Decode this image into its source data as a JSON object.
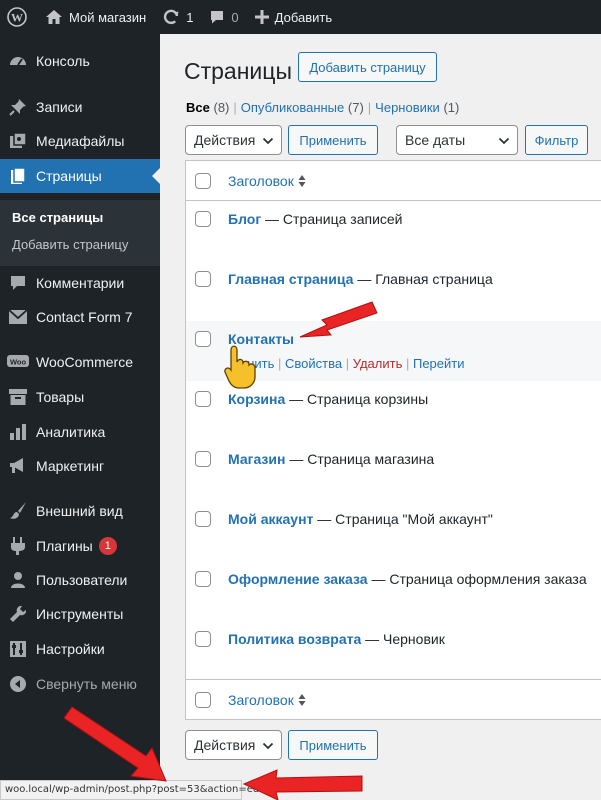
{
  "adminbar": {
    "site_name": "Мой магазин",
    "updates_count": "1",
    "comments_count": "0",
    "new_label": "Добавить"
  },
  "menu": {
    "items": [
      {
        "label": "Консоль",
        "icon": "dashboard-icon"
      },
      {
        "label": "Записи",
        "icon": "pin-icon"
      },
      {
        "label": "Медиафайлы",
        "icon": "media-icon"
      },
      {
        "label": "Страницы",
        "icon": "pages-icon"
      },
      {
        "label": "Комментарии",
        "icon": "comment-icon"
      },
      {
        "label": "Contact Form 7",
        "icon": "mail-icon"
      },
      {
        "label": "WooCommerce",
        "icon": "woo-icon"
      },
      {
        "label": "Товары",
        "icon": "archive-icon"
      },
      {
        "label": "Аналитика",
        "icon": "chart-icon"
      },
      {
        "label": "Маркетинг",
        "icon": "megaphone-icon"
      },
      {
        "label": "Внешний вид",
        "icon": "brush-icon"
      },
      {
        "label": "Плагины",
        "icon": "plugin-icon",
        "badge": "1"
      },
      {
        "label": "Пользователи",
        "icon": "users-icon"
      },
      {
        "label": "Инструменты",
        "icon": "wrench-icon"
      },
      {
        "label": "Настройки",
        "icon": "settings-icon"
      },
      {
        "label": "Свернуть меню",
        "icon": "collapse-icon"
      }
    ],
    "submenu": [
      "Все страницы",
      "Добавить страницу"
    ]
  },
  "page": {
    "title": "Страницы",
    "add_new": "Добавить страницу",
    "views": [
      {
        "label": "Все",
        "count": "(8)"
      },
      {
        "label": "Опубликованные",
        "count": "(7)"
      },
      {
        "label": "Черновики",
        "count": "(1)"
      }
    ],
    "bulk_actions": "Действия",
    "apply": "Применить",
    "dates": "Все даты",
    "filter": "Фильтр",
    "column_title": "Заголовок"
  },
  "rows": [
    {
      "title": "Блог",
      "state": " — Страница записей"
    },
    {
      "title": "Главная страница",
      "state": " — Главная страница"
    },
    {
      "title": "Контакты",
      "state": ""
    },
    {
      "title": "Корзина",
      "state": " — Страница корзины"
    },
    {
      "title": "Магазин",
      "state": " — Страница магазина"
    },
    {
      "title": "Мой аккаунт",
      "state": " — Страница \"Мой аккаунт\""
    },
    {
      "title": "Оформление заказа",
      "state": " — Страница оформления заказа"
    },
    {
      "title": "Политика возврата",
      "state": " — Черновик"
    }
  ],
  "row_actions": {
    "edit": "Изменить",
    "edit_visible": "енить",
    "quick_edit": "Свойства",
    "trash": "Удалить",
    "view": "Перейти"
  },
  "statusbar": {
    "url": "woo.local/wp-admin/post.php?post=53&action=edit"
  },
  "colors": {
    "adminbar": "#1d2327",
    "accent": "#2271b1",
    "delete": "#b32d2e",
    "badge": "#d63638",
    "annotation_arrow": "#ea2424"
  }
}
